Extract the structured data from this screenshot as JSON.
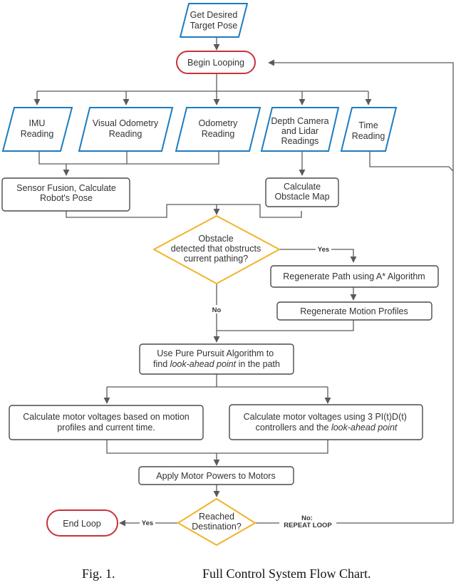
{
  "diagram": {
    "type": "flowchart",
    "nodes": {
      "get_target": {
        "shape": "parallelogram",
        "lines": [
          "Get Desired",
          "Target Pose"
        ]
      },
      "begin": {
        "shape": "terminator",
        "lines": [
          "Begin Looping"
        ]
      },
      "imu": {
        "shape": "parallelogram",
        "lines": [
          "IMU",
          "Reading"
        ]
      },
      "vo": {
        "shape": "parallelogram",
        "lines": [
          "Visual Odometry",
          "Reading"
        ]
      },
      "odo": {
        "shape": "parallelogram",
        "lines": [
          "Odometry",
          "Reading"
        ]
      },
      "depth": {
        "shape": "parallelogram",
        "lines": [
          "Depth Camera",
          "and Lidar",
          "Readings"
        ]
      },
      "time": {
        "shape": "parallelogram",
        "lines": [
          "Time",
          "Reading"
        ]
      },
      "fusion": {
        "shape": "process",
        "lines": [
          "Sensor Fusion, Calculate",
          "Robot's Pose"
        ]
      },
      "obstacle_map": {
        "shape": "process",
        "lines": [
          "Calculate",
          "Obstacle Map"
        ]
      },
      "obstacle_q": {
        "shape": "decision",
        "lines": [
          "Obstacle",
          "detected that obstructs",
          "current pathing?"
        ]
      },
      "regen_path": {
        "shape": "process",
        "lines": [
          "Regenerate Path using A* Algorithm"
        ]
      },
      "regen_motion": {
        "shape": "process",
        "lines": [
          "Regenerate Motion Profiles"
        ]
      },
      "pure_pursuit": {
        "shape": "process",
        "line1": "Use Pure Pursuit Algorithm to",
        "line2_pre": "find ",
        "line2_italic": "look-ahead point",
        "line2_post": " in the path"
      },
      "calc_motion": {
        "shape": "process",
        "lines": [
          "Calculate motor voltages based on motion",
          "profiles and current time."
        ]
      },
      "calc_pid": {
        "shape": "process",
        "line1": "Calculate motor voltages using 3 PI(t)D(t)",
        "line2_pre": "controllers and the ",
        "line2_italic": "look-ahead point",
        "line2_post": ""
      },
      "apply": {
        "shape": "process",
        "lines": [
          "Apply Motor Powers to Motors"
        ]
      },
      "reached_q": {
        "shape": "decision",
        "lines": [
          "Reached",
          "Destination?"
        ]
      },
      "end": {
        "shape": "terminator",
        "lines": [
          "End Loop"
        ]
      }
    },
    "edge_labels": {
      "obstacle_yes": "Yes",
      "obstacle_no": "No",
      "reached_yes": "Yes",
      "reached_no_1": "No:",
      "reached_no_2": "REPEAT LOOP"
    },
    "colors": {
      "io_border": "#1d7cc0",
      "terminator_border": "#c8323a",
      "decision_border": "#f0b429",
      "process_border": "#4a4a4a",
      "connector": "#5a5a5a"
    }
  },
  "caption": {
    "fig": "Fig. 1.",
    "title": "Full Control System Flow Chart."
  }
}
